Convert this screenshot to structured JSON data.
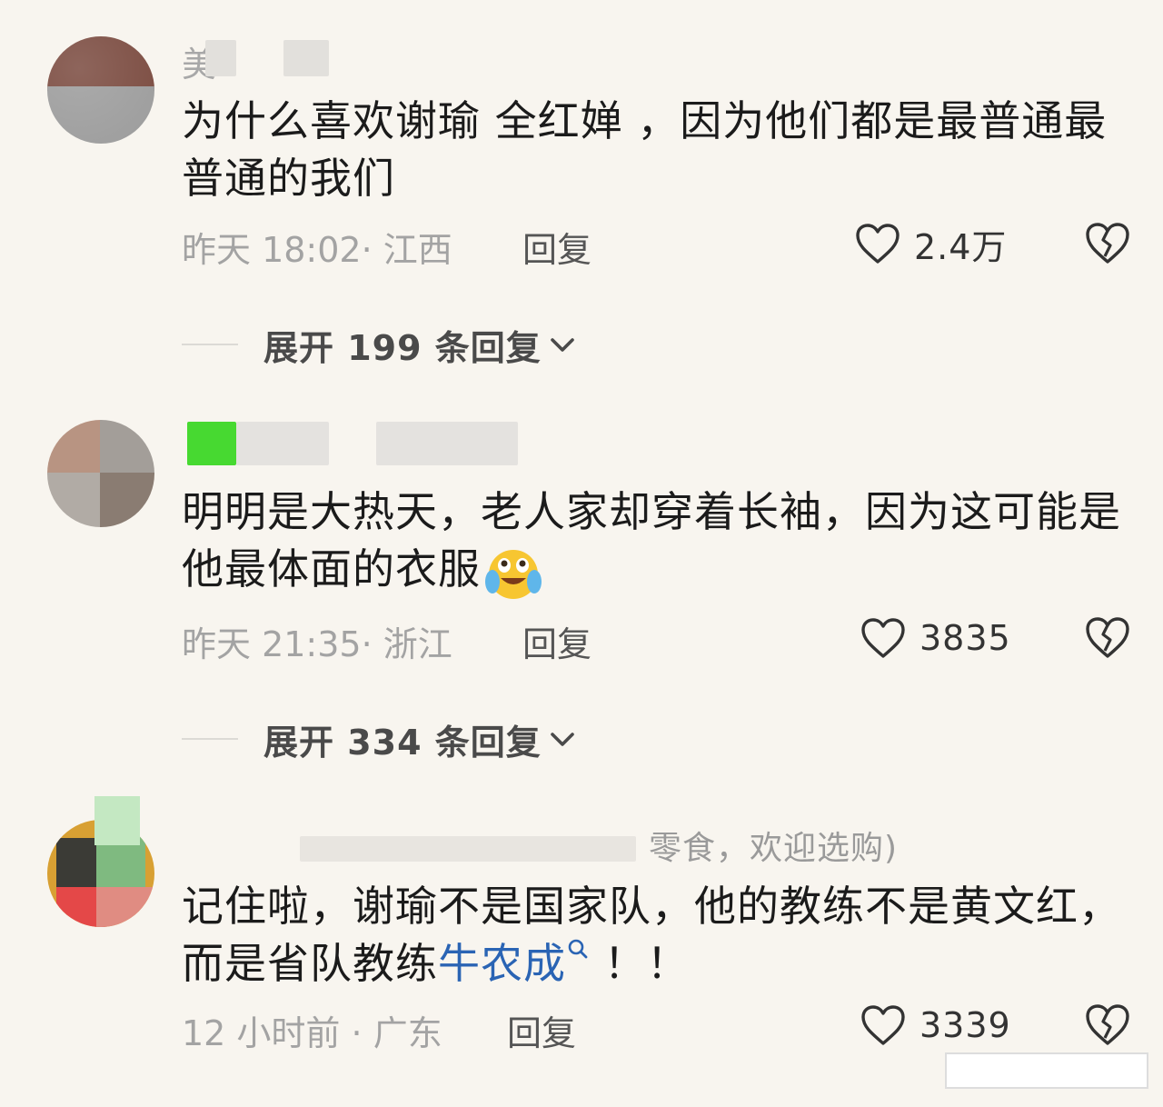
{
  "comments": [
    {
      "name_prefix": "美",
      "text": "为什么喜欢谢瑜 全红婵 ，因为他们都是最普通最普通的我们",
      "time": "昨天 18:02",
      "region": "江西",
      "reply_label": "回复",
      "likes": "2.4万",
      "expand_label": "展开 199 条回复"
    },
    {
      "text": "明明是大热天，老人家却穿着长袖，因为这可能是他最体面的衣服",
      "emoji": "crying-laughing-emoji",
      "time": "昨天 21:35",
      "region": "浙江",
      "reply_label": "回复",
      "likes": "3835",
      "expand_label": "展开 334 条回复"
    },
    {
      "name_sub": "零食，欢迎选购)",
      "text_before": "记住啦，谢瑜不是国家队，他的教练不是黄文红，而是省队教练",
      "link": "牛农成",
      "text_after": " ！！",
      "time": "12 小时前",
      "region": "广东",
      "reply_label": "回复",
      "likes": "3339"
    }
  ],
  "icons": {
    "like": "heart-outline-icon",
    "dislike": "broken-heart-icon",
    "expand": "chevron-down-icon",
    "link_search": "search-icon"
  },
  "colors": {
    "background": "#f8f5ef",
    "link": "#2a64b4",
    "meta": "#a3a3a3"
  }
}
